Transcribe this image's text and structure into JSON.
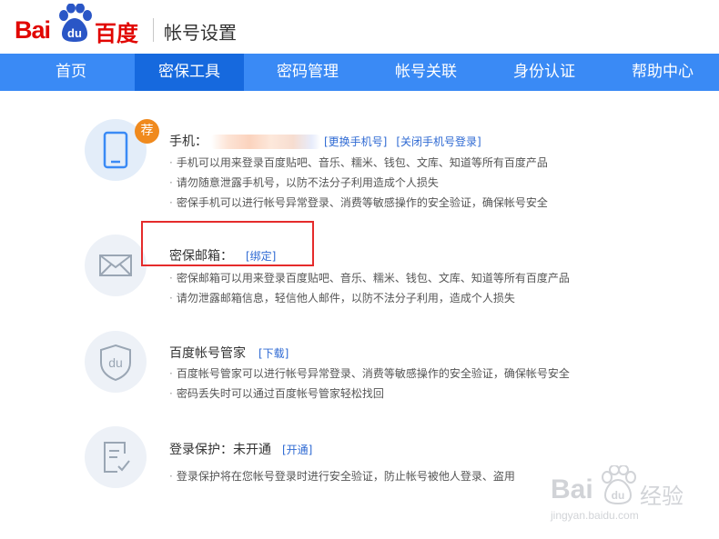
{
  "header": {
    "logo_bai": "Bai",
    "logo_du": "du",
    "logo_cn": "百度",
    "title": "帐号设置"
  },
  "nav": {
    "items": [
      {
        "label": "首页"
      },
      {
        "label": "密保工具",
        "active": true
      },
      {
        "label": "密码管理"
      },
      {
        "label": "帐号关联"
      },
      {
        "label": "身份认证"
      },
      {
        "label": "帮助中心"
      }
    ]
  },
  "phone": {
    "badge": "荐",
    "label": "手机：",
    "change_link": "[更换手机号]",
    "close_login_link": "[关闭手机号登录]",
    "bullets": [
      "手机可以用来登录百度贴吧、音乐、糯米、钱包、文库、知道等所有百度产品",
      "请勿随意泄露手机号，以防不法分子利用造成个人损失",
      "密保手机可以进行帐号异常登录、消费等敏感操作的安全验证，确保帐号安全"
    ]
  },
  "email": {
    "label": "密保邮箱：",
    "bind_link": "[绑定]",
    "bullets": [
      "密保邮箱可以用来登录百度贴吧、音乐、糯米、钱包、文库、知道等所有百度产品",
      "请勿泄露邮箱信息，轻信他人邮件，以防不法分子利用，造成个人损失"
    ]
  },
  "manager": {
    "label": "百度帐号管家",
    "download_link": "[下载]",
    "bullets": [
      "百度帐号管家可以进行帐号异常登录、消费等敏感操作的安全验证，确保帐号安全",
      "密码丢失时可以通过百度帐号管家轻松找回"
    ]
  },
  "protect": {
    "label": "登录保护：未开通",
    "open_link": "[开通]",
    "bullets": [
      "登录保护将在您帐号登录时进行安全验证，防止帐号被他人登录、盗用"
    ]
  },
  "watermark": {
    "brand_bai": "Bai",
    "brand_du": "du",
    "brand_cn": "经验",
    "url": "jingyan.baidu.com"
  },
  "colors": {
    "brand_red": "#e10602",
    "nav_blue": "#3a8af5",
    "nav_active": "#1669de",
    "link_blue": "#2f6ad3",
    "badge_orange": "#f08a1e",
    "highlight_red": "#e52b2b"
  }
}
